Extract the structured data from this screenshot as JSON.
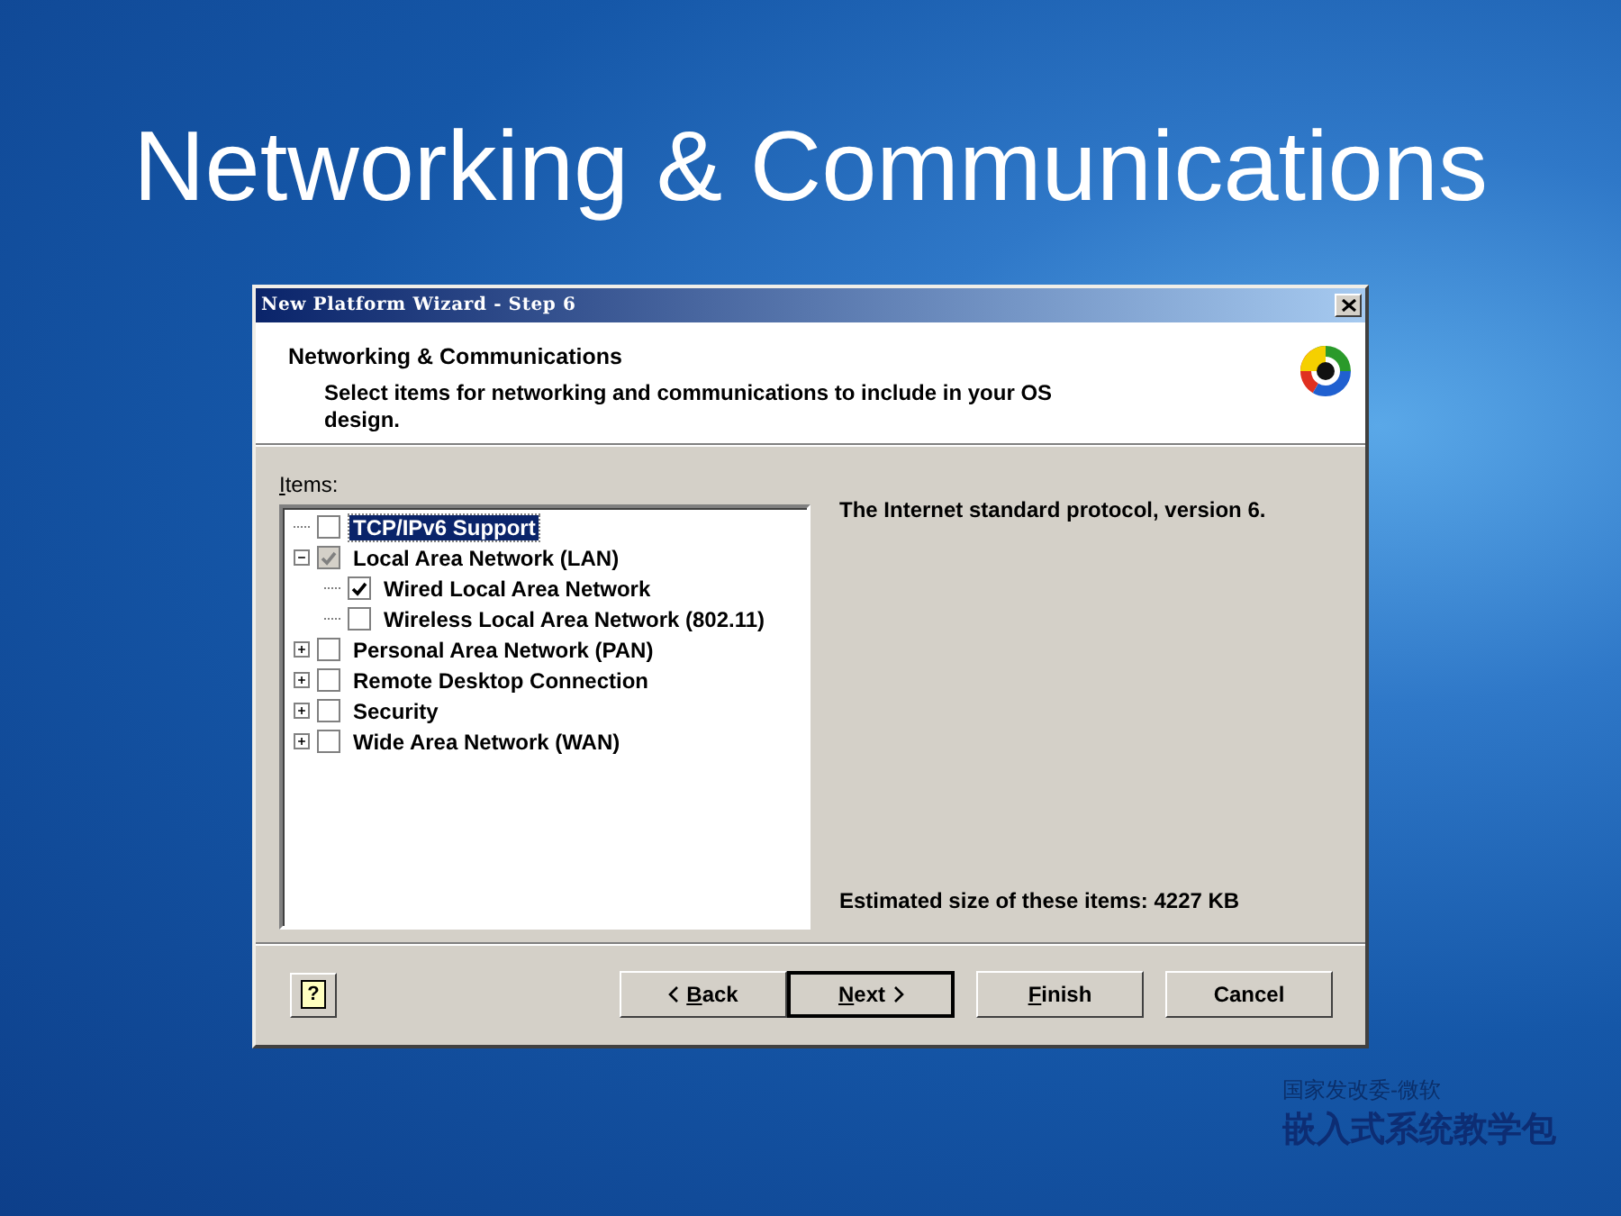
{
  "slide_title": "Networking & Communications",
  "window": {
    "title": "New Platform Wizard - Step 6",
    "header": {
      "title": "Networking & Communications",
      "subtitle": "Select items for networking and communications to include in your OS design."
    },
    "items_label": {
      "text": "Items:",
      "underline_first": true
    },
    "tree": [
      {
        "label": "TCP/IPv6 Support",
        "checked": false,
        "disabled": false,
        "selected": true
      },
      {
        "label": "Local Area Network (LAN)",
        "checked": true,
        "disabled": true,
        "selected": false,
        "expanded": true,
        "children": [
          {
            "label": "Wired Local Area Network",
            "checked": true,
            "disabled": false,
            "selected": false
          },
          {
            "label": "Wireless Local Area Network (802.11)",
            "checked": false,
            "disabled": false,
            "selected": false
          }
        ]
      },
      {
        "label": "Personal Area Network (PAN)",
        "checked": false,
        "disabled": false,
        "selected": false,
        "expanded": false
      },
      {
        "label": "Remote Desktop Connection",
        "checked": false,
        "disabled": false,
        "selected": false,
        "expanded": false
      },
      {
        "label": "Security",
        "checked": false,
        "disabled": false,
        "selected": false,
        "expanded": false
      },
      {
        "label": "Wide Area Network (WAN)",
        "checked": false,
        "disabled": false,
        "selected": false,
        "expanded": false
      }
    ],
    "description": "The Internet standard protocol, version 6.",
    "estimated_size": "Estimated size of these items: 4227 KB",
    "help_glyph": "?",
    "buttons": [
      {
        "kind": "back",
        "label": "Back",
        "underline_first": true,
        "default": false
      },
      {
        "kind": "next",
        "label": "Next",
        "underline_first": true,
        "default": true
      },
      {
        "kind": "plain",
        "label": "Finish",
        "underline_first": true,
        "default": false
      },
      {
        "kind": "plain",
        "label": "Cancel",
        "underline_first": false,
        "default": false
      }
    ]
  },
  "brand": {
    "line1": "国家发改委-微软",
    "line2": "嵌入式系统教学包"
  }
}
